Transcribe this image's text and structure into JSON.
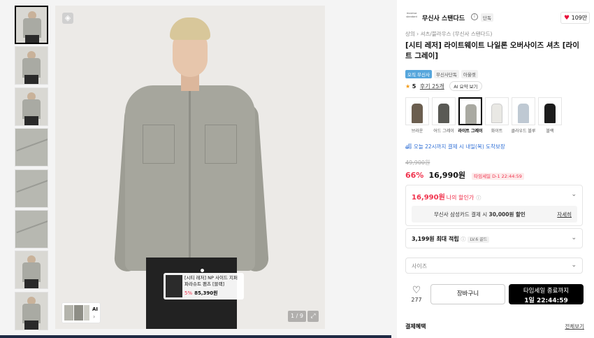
{
  "gallery": {
    "thumbnail_count": 8,
    "selected_index": 0,
    "tag": {
      "name": "[시티 레저] NP 사이드 지퍼 파라슈트 팬츠 [블랙]",
      "discount": "5%",
      "price": "85,390원"
    },
    "ai_chip_label": "AI",
    "counter": "1 / 9"
  },
  "brand": {
    "logo_text": "musinsa standard",
    "name": "무신사 스탠다드",
    "exclusive": "단독",
    "likes": "109만"
  },
  "breadcrumb": "상의 › 셔츠/블라우스 (무신사 스탠다드)",
  "title": "[시티 레저] 라이트웨이트 나일론 오버사이즈 셔츠 [라이트 그레이]",
  "badges": [
    "오직 무신사",
    "무신사단독",
    "아울렛"
  ],
  "rating": {
    "score": "5",
    "reviews": "후기 25개",
    "ai_summary": "AI 요약 보기"
  },
  "colors": [
    {
      "label": "브라운",
      "color": "#6b5e4f"
    },
    {
      "label": "어드 그레이",
      "color": "#5a5a55"
    },
    {
      "label": "라이트 그레이",
      "color": "#a9a9a1",
      "selected": true
    },
    {
      "label": "화이트",
      "color": "#e9e8e4"
    },
    {
      "label": "클라우드 블루",
      "color": "#bfc9d3"
    },
    {
      "label": "블랙",
      "color": "#1c1c1c"
    }
  ],
  "delivery": "오늘 22시까지 결제 시 내일(목) 도착보장",
  "pricing": {
    "original": "49,900원",
    "discount": "66%",
    "price": "16,990원",
    "timesale": "타임세일 D-1 22:44:59",
    "my_price": "16,990원",
    "my_price_label": "나의 할인가",
    "card_prefix": "무신사 삼성카드 결제 시",
    "card_amount": "30,000원 할인",
    "card_detail": "자세히",
    "points": "3,199원 최대 적립",
    "points_level": "LV.6 골드"
  },
  "size_placeholder": "사이즈",
  "actions": {
    "wish_count": "277",
    "cart": "장바구니",
    "buy_label": "타임세일 종료까지",
    "buy_time": "1일 22:44:59"
  },
  "benefits": {
    "title": "결제혜택",
    "all": "전체보기"
  },
  "accent": {
    "red": "#f0334d",
    "blue": "#2f6fd6"
  }
}
